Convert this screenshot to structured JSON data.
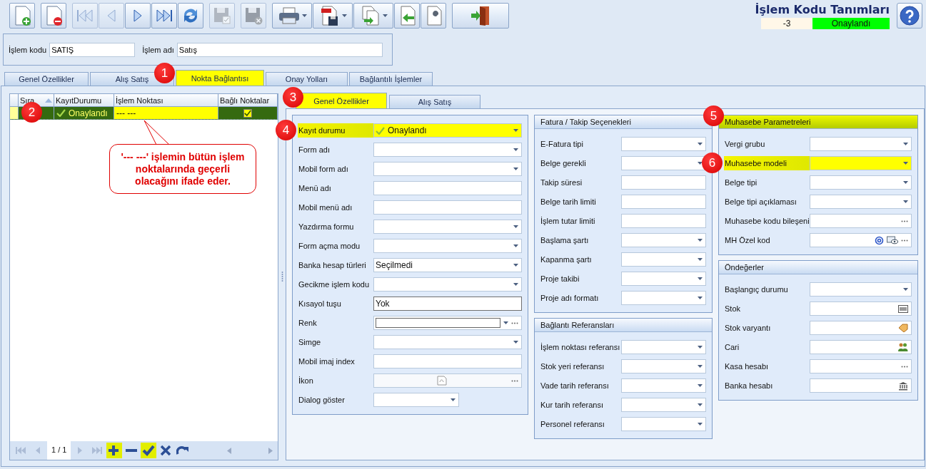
{
  "toolbar": {
    "groups": [
      [
        {
          "kind": "new",
          "disabled": false
        }
      ],
      [
        {
          "kind": "delete",
          "disabled": false
        }
      ],
      [
        {
          "kind": "first",
          "disabled": true
        },
        {
          "kind": "prev",
          "disabled": true
        },
        {
          "kind": "next",
          "disabled": false
        },
        {
          "kind": "last",
          "disabled": false
        },
        {
          "kind": "refresh",
          "disabled": false
        }
      ],
      [
        {
          "kind": "save",
          "disabled": true
        }
      ],
      [
        {
          "kind": "cancel",
          "disabled": true
        }
      ],
      [
        {
          "kind": "print",
          "disabled": false,
          "dropdown": true
        },
        {
          "kind": "pdf",
          "disabled": false,
          "dropdown": true
        },
        {
          "kind": "export",
          "disabled": false,
          "dropdown": true
        },
        {
          "kind": "import",
          "disabled": false
        },
        {
          "kind": "tools",
          "disabled": false
        }
      ],
      [
        {
          "kind": "exit",
          "disabled": false
        }
      ]
    ]
  },
  "header": {
    "title": "İşlem Kodu Tanımları",
    "record": "-3",
    "status": "Onaylandı"
  },
  "code_fields": [
    {
      "label": "İşlem kodu",
      "value": "SATIŞ"
    },
    {
      "label": "İşlem adı",
      "value": "Satış"
    }
  ],
  "tabs": [
    {
      "label": "Genel Özellikler",
      "selected": false,
      "highlighted": false
    },
    {
      "label": "Alış Satış",
      "selected": false,
      "highlighted": false
    },
    {
      "label": "Nokta Bağlantısı",
      "selected": true,
      "highlighted": true,
      "marker": "1"
    },
    {
      "label": "Onay Yolları",
      "selected": false,
      "highlighted": false
    },
    {
      "label": "Bağlantılı İşlemler",
      "selected": false,
      "highlighted": false
    }
  ],
  "grid": {
    "columns": [
      {
        "label": "Sıra",
        "sorted": true
      },
      {
        "label": "KayıtDurumu",
        "sorted": false
      },
      {
        "label": "İşlem Noktası",
        "sorted": false
      },
      {
        "label": "Bağlı Noktalar",
        "sorted": false
      }
    ],
    "rows": [
      {
        "selected": true,
        "marker": "2",
        "cells": [
          {
            "kind": "text",
            "focused": false
          },
          {
            "kind": "status",
            "text": "Onaylandı",
            "focused": false
          },
          {
            "kind": "text",
            "text": "--- ---",
            "focused": true
          },
          {
            "kind": "check",
            "checked": true,
            "focused": false
          }
        ]
      }
    ],
    "callout": "'--- ---' işlemin bütün işlem noktalarında geçerli olacağını ifade eder.",
    "navigator": {
      "position": "1 / 1",
      "buttons": [
        {
          "kind": "first",
          "disabled": true,
          "highlighted": false
        },
        {
          "kind": "prev",
          "disabled": true,
          "highlighted": false
        },
        {
          "kind": "position"
        },
        {
          "kind": "next",
          "disabled": true,
          "highlighted": false
        },
        {
          "kind": "last",
          "disabled": true,
          "highlighted": false
        },
        {
          "kind": "add",
          "disabled": false,
          "highlighted": true
        },
        {
          "kind": "remove",
          "disabled": false,
          "highlighted": false
        },
        {
          "kind": "confirm",
          "disabled": false,
          "highlighted": true
        },
        {
          "kind": "cancel",
          "disabled": false,
          "highlighted": false
        },
        {
          "kind": "redo",
          "disabled": false,
          "highlighted": false
        }
      ]
    }
  },
  "subtabs": [
    {
      "label": "Genel Özellikler",
      "selected": true,
      "highlighted": true,
      "marker": "3"
    },
    {
      "label": "Alış Satış",
      "selected": false,
      "highlighted": false
    }
  ],
  "columns": [
    [
      {
        "fields": [
          {
            "label": "Kayıt durumu",
            "kind": "status",
            "value": "Onaylandı",
            "highlighted": true,
            "marker": "4"
          },
          {
            "label": "Form adı",
            "kind": "combo",
            "highlighted": false
          },
          {
            "label": "Mobil form adı",
            "kind": "combo",
            "highlighted": false
          },
          {
            "label": "Menü adı",
            "kind": "text",
            "highlighted": false
          },
          {
            "label": "Mobil menü adı",
            "kind": "text",
            "highlighted": false
          },
          {
            "label": "Yazdırma formu",
            "kind": "combo",
            "highlighted": false
          },
          {
            "label": "Form açma modu",
            "kind": "combo",
            "highlighted": false
          },
          {
            "label": "Banka hesap türleri",
            "kind": "combo",
            "value": "Seçilmedi",
            "highlighted": false
          },
          {
            "label": "Gecikme işlem kodu",
            "kind": "combo",
            "highlighted": false
          },
          {
            "label": "Kısayol tuşu",
            "kind": "hotkey",
            "value": "Yok",
            "highlighted": false
          },
          {
            "label": "Renk",
            "kind": "color",
            "highlighted": false
          },
          {
            "label": "Simge",
            "kind": "combo",
            "highlighted": false
          },
          {
            "label": "Mobil imaj index",
            "kind": "text",
            "highlighted": false
          },
          {
            "label": "İkon",
            "kind": "image",
            "highlighted": false
          },
          {
            "label": "Dialog göster",
            "kind": "short-combo",
            "highlighted": false
          }
        ]
      }
    ],
    [
      {
        "title": "Fatura / Takip Seçenekleri",
        "highlighted": false,
        "fields": [
          {
            "label": "E-Fatura tipi",
            "kind": "combo",
            "highlighted": false
          },
          {
            "label": "Belge gerekli",
            "kind": "combo",
            "highlighted": false
          },
          {
            "label": "Takip süresi",
            "kind": "text",
            "highlighted": false
          },
          {
            "label": "Belge tarih limiti",
            "kind": "text",
            "highlighted": false
          },
          {
            "label": "İşlem tutar limiti",
            "kind": "text",
            "highlighted": false
          },
          {
            "label": "Başlama şartı",
            "kind": "combo",
            "highlighted": false
          },
          {
            "label": "Kapanma şartı",
            "kind": "combo",
            "highlighted": false
          },
          {
            "label": "Proje takibi",
            "kind": "combo",
            "highlighted": false
          },
          {
            "label": "Proje adı formatı",
            "kind": "combo",
            "highlighted": false
          }
        ]
      },
      {
        "title": "Bağlantı Referansları",
        "highlighted": false,
        "fields": [
          {
            "label": "İşlem noktası referansı",
            "kind": "combo",
            "highlighted": false
          },
          {
            "label": "Stok yeri referansı",
            "kind": "combo",
            "highlighted": false
          },
          {
            "label": "Vade tarih referansı",
            "kind": "combo",
            "highlighted": false
          },
          {
            "label": "Kur tarih referansı",
            "kind": "combo",
            "highlighted": false
          },
          {
            "label": "Personel referansı",
            "kind": "combo",
            "highlighted": false
          }
        ]
      }
    ],
    [
      {
        "title": "Muhasebe Parametreleri",
        "highlighted": true,
        "marker": "5",
        "fields": [
          {
            "label": "Vergi grubu",
            "kind": "combo",
            "highlighted": false
          },
          {
            "label": "Muhasebe modeli",
            "kind": "combo",
            "highlighted": true,
            "marker": "6"
          },
          {
            "label": "Belge tipi",
            "kind": "combo",
            "highlighted": false
          },
          {
            "label": "Belge tipi açıklaması",
            "kind": "combo",
            "highlighted": false
          },
          {
            "label": "Muhasebe kodu bileşeni",
            "kind": "ellipsis",
            "highlighted": false
          },
          {
            "label": "MH Özel kod",
            "kind": "special",
            "highlighted": false
          }
        ]
      },
      {
        "title": "Öndeğerler",
        "highlighted": false,
        "fields": [
          {
            "label": "Başlangıç durumu",
            "kind": "combo",
            "highlighted": false
          },
          {
            "label": "Stok",
            "kind": "barcode",
            "highlighted": false
          },
          {
            "label": "Stok varyantı",
            "kind": "tag",
            "highlighted": false
          },
          {
            "label": "Cari",
            "kind": "people",
            "highlighted": false
          },
          {
            "label": "Kasa hesabı",
            "kind": "ellipsis",
            "highlighted": false
          },
          {
            "label": "Banka hesabı",
            "kind": "bank",
            "highlighted": false
          }
        ]
      }
    ]
  ]
}
